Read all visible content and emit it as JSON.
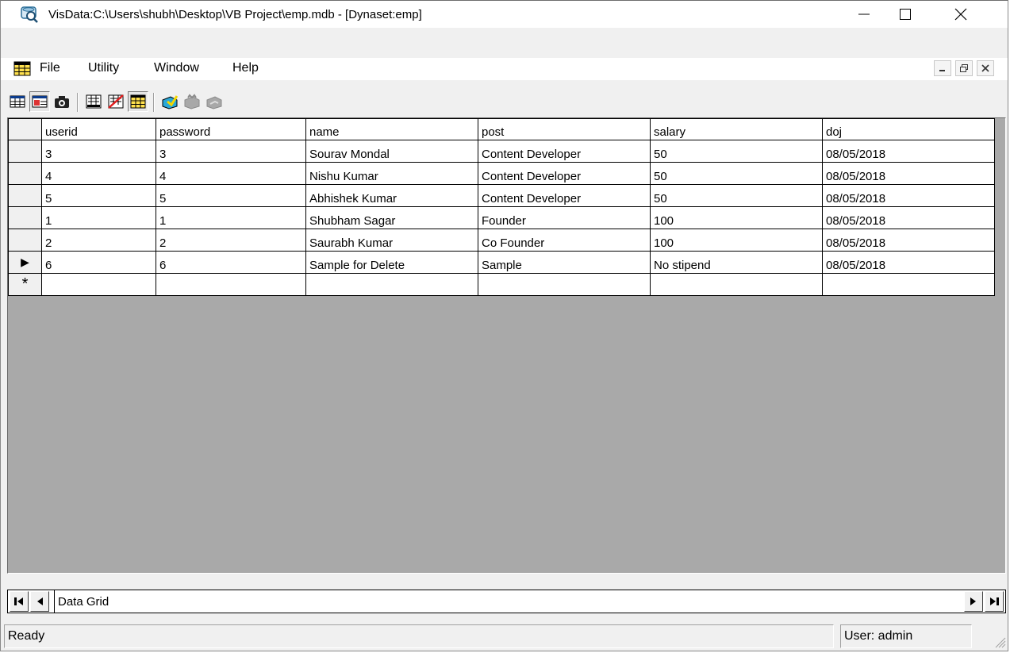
{
  "window": {
    "title": "VisData:C:\\Users\\shubh\\Desktop\\VB Project\\emp.mdb - [Dynaset:emp]",
    "icons": {
      "app": "visdata-app-icon",
      "minimize": "minimize-icon",
      "maximize": "maximize-icon",
      "close": "close-icon"
    }
  },
  "menu": {
    "items": [
      "File",
      "Utility",
      "Window",
      "Help"
    ],
    "mdi_controls": [
      "_",
      "ə",
      "x"
    ]
  },
  "toolbar": {
    "buttons": [
      {
        "icon": "table-recordset-icon",
        "pressed": false
      },
      {
        "icon": "dynaset-recordset-icon",
        "pressed": true
      },
      {
        "icon": "snapshot-recordset-icon",
        "pressed": false
      },
      {
        "icon": "data-control-form-icon",
        "pressed": false
      },
      {
        "icon": "no-data-control-form-icon",
        "pressed": false
      },
      {
        "icon": "data-grid-form-icon",
        "pressed": true
      },
      {
        "icon": "begin-transaction-icon",
        "pressed": false
      },
      {
        "icon": "commit-transaction-icon",
        "pressed": false,
        "disabled": true
      },
      {
        "icon": "rollback-transaction-icon",
        "pressed": false,
        "disabled": true
      }
    ]
  },
  "grid": {
    "columns": [
      "userid",
      "password",
      "name",
      "post",
      "salary",
      "doj"
    ],
    "rows": [
      [
        "3",
        "3",
        "Sourav Mondal",
        "Content Developer",
        "50",
        "08/05/2018"
      ],
      [
        "4",
        "4",
        "Nishu Kumar",
        "Content Developer",
        "50",
        "08/05/2018"
      ],
      [
        "5",
        "5",
        "Abhishek Kumar",
        "Content Developer",
        "50",
        "08/05/2018"
      ],
      [
        "1",
        "1",
        "Shubham Sagar",
        "Founder",
        "100",
        "08/05/2018"
      ],
      [
        "2",
        "2",
        "Saurabh Kumar",
        "Co Founder",
        "100",
        "08/05/2018"
      ],
      [
        "6",
        "6",
        "Sample for Delete",
        "Sample",
        "No stipend",
        "08/05/2018"
      ]
    ],
    "current_row_index": 5,
    "new_row_marker": "*",
    "current_row_marker": "▶"
  },
  "navigator": {
    "caption": "Data Grid",
    "buttons": [
      "first-record-icon",
      "previous-record-icon",
      "next-record-icon",
      "last-record-icon"
    ]
  },
  "status": {
    "text": "Ready",
    "user": "User: admin"
  }
}
